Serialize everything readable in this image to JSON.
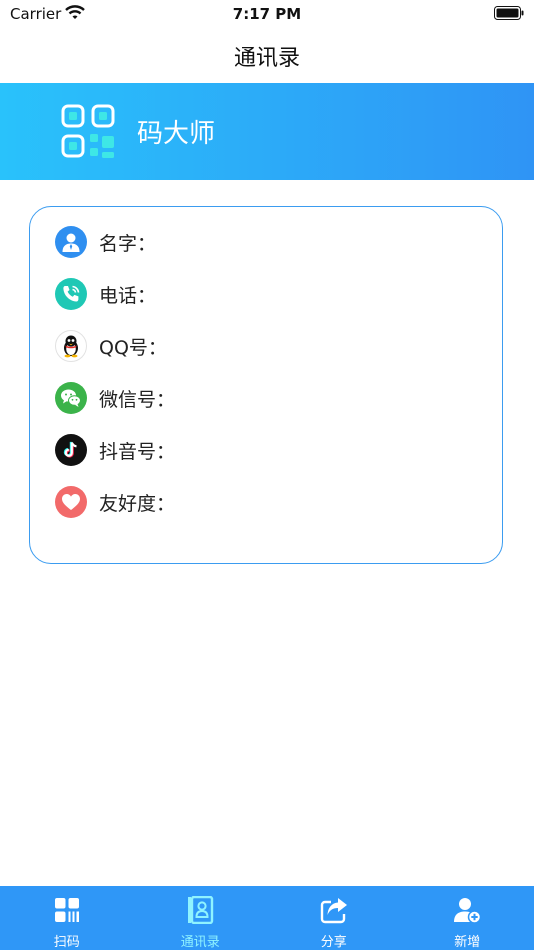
{
  "status_bar": {
    "carrier": "Carrier",
    "time": "7:17 PM"
  },
  "nav": {
    "title": "通讯录"
  },
  "banner": {
    "brand": "码大师"
  },
  "card": {
    "rows": [
      {
        "label": "名字：",
        "icon": "person-icon",
        "color": "#2f8ff0"
      },
      {
        "label": "电话：",
        "icon": "phone-icon",
        "color": "#1fc8b5"
      },
      {
        "label": "QQ号：",
        "icon": "qq-penguin-icon",
        "color": "#ffffff"
      },
      {
        "label": "微信号：",
        "icon": "wechat-icon",
        "color": "#3bb34a"
      },
      {
        "label": "抖音号：",
        "icon": "tiktok-icon",
        "color": "#111111"
      },
      {
        "label": "友好度：",
        "icon": "heart-icon",
        "color": "#f26a6a"
      }
    ]
  },
  "tabs": [
    {
      "label": "扫码",
      "icon": "scan-grid-icon",
      "active": false
    },
    {
      "label": "通讯录",
      "icon": "contacts-book-icon",
      "active": true
    },
    {
      "label": "分享",
      "icon": "share-icon",
      "active": false
    },
    {
      "label": "新增",
      "icon": "add-user-icon",
      "active": false
    }
  ],
  "colors": {
    "accent": "#2f97f7",
    "active_tab": "#8ff3ff",
    "card_border": "#3b9cf0"
  }
}
